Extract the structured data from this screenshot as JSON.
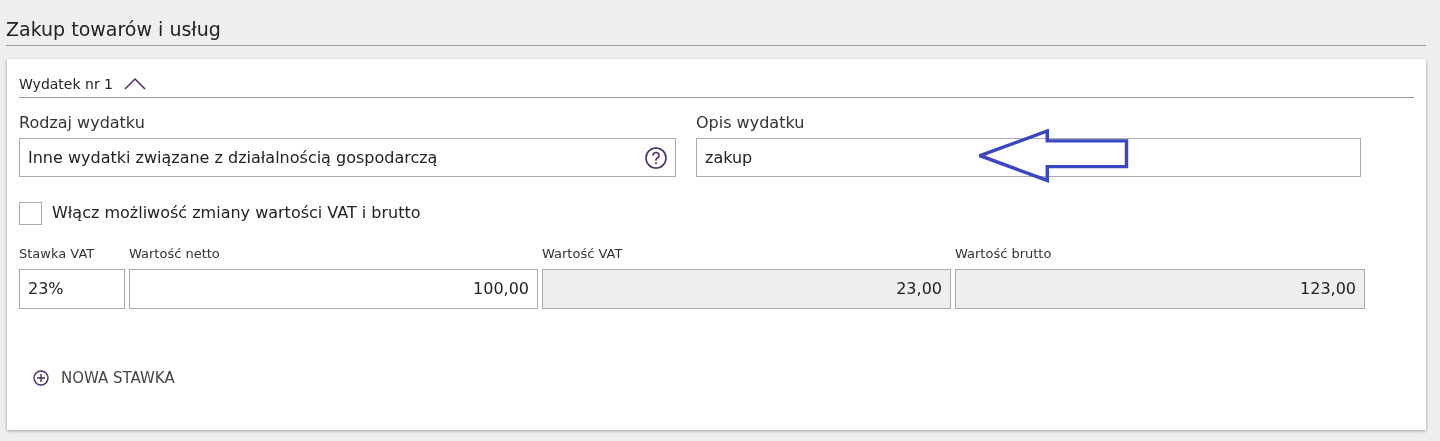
{
  "section_title": "Zakup towarów i usług",
  "expense": {
    "title": "Wydatek nr 1",
    "expanded": true,
    "fields": [
      {
        "label": "Rodzaj wydatku",
        "value": "Inne wydatki związane z działalnością gospodarczą",
        "kind": "select"
      },
      {
        "label": "Opis wydatku",
        "value": "zakup",
        "kind": "text"
      }
    ],
    "vat_toggle": {
      "label": "Włącz możliwość zmiany wartości VAT i brutto",
      "checked": false
    },
    "rate_fields": [
      {
        "label": "Stawka VAT",
        "value": "23%",
        "disabled": false
      },
      {
        "label": "Wartość netto",
        "value": "100,00",
        "disabled": false
      },
      {
        "label": "Wartość VAT",
        "value": "23,00",
        "disabled": true
      },
      {
        "label": "Wartość brutto",
        "value": "123,00",
        "disabled": true
      }
    ],
    "add_button": "NOWA STAWKA"
  }
}
